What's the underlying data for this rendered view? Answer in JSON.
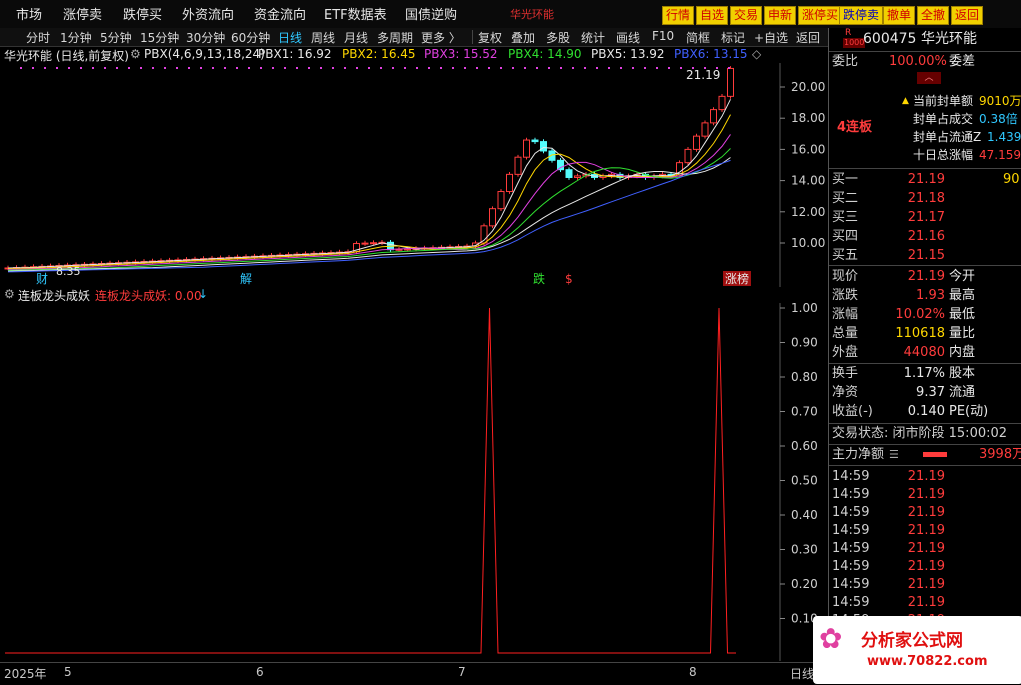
{
  "topbar": {
    "menus": [
      "市场",
      "涨停卖",
      "跌停买",
      "外资流向",
      "资金流向",
      "ETF数据表",
      "国债逆购",
      "华光环能"
    ],
    "buttons": [
      "行情",
      "自选",
      "交易",
      "申新",
      "涨停买",
      "跌停卖",
      "撤单",
      "全撤",
      "返回"
    ]
  },
  "periodbar": {
    "periods": [
      "分时",
      "1分钟",
      "5分钟",
      "15分钟",
      "30分钟",
      "60分钟",
      "日线",
      "周线",
      "月线",
      "多周期",
      "更多 〉"
    ],
    "active_period": "日线",
    "tools": [
      "复权",
      "叠加",
      "多股",
      "统计",
      "画线",
      "F10",
      "简框",
      "标记",
      "+自选",
      "返回"
    ]
  },
  "main_chart": {
    "title": "华光环能 (日线,前复权)",
    "indicator_name": "PBX(4,6,9,13,18,24)",
    "pbx": [
      {
        "label": "PBX1: 16.92",
        "color": "#e8e8e8"
      },
      {
        "label": "PBX2: 16.45",
        "color": "#ffd700"
      },
      {
        "label": "PBX3: 15.52",
        "color": "#e040e0"
      },
      {
        "label": "PBX4: 14.90",
        "color": "#30e030"
      },
      {
        "label": "PBX5: 13.92",
        "color": "#e8e8e8"
      },
      {
        "label": "PBX6: 13.15",
        "color": "#4060ff"
      }
    ],
    "y_ticks": [
      "20.00",
      "18.00",
      "16.00",
      "14.00",
      "12.00",
      "10.00"
    ],
    "last_price_label": "21.19",
    "low_label": "8.35",
    "markers": [
      "财",
      "解",
      "跌",
      "$",
      "涨榜"
    ]
  },
  "indicator": {
    "name": "连板龙头成妖",
    "value_label": "连板龙头成妖: 0.00",
    "y_ticks": [
      "1.00",
      "0.90",
      "0.80",
      "0.70",
      "0.60",
      "0.50",
      "0.40",
      "0.30",
      "0.20",
      "0.10"
    ]
  },
  "date_axis": {
    "labels": [
      "2025年",
      "5",
      "6",
      "7",
      "8"
    ],
    "period_label": "日线"
  },
  "chart_data": {
    "type": "line",
    "title": "",
    "xlabel": "",
    "ylabel": "",
    "ylim": [
      0,
      1.05
    ],
    "x": [
      0,
      1,
      2,
      3,
      4,
      5,
      6,
      7,
      8,
      9,
      10,
      11,
      12,
      13,
      14,
      15,
      16,
      17,
      18,
      19,
      20,
      21,
      22,
      23,
      24,
      25,
      26,
      27,
      28,
      29,
      30,
      31,
      32,
      33,
      34,
      35,
      36,
      37,
      38,
      39,
      40,
      41,
      42,
      43,
      44,
      45,
      46,
      47,
      48,
      49,
      50,
      51,
      52,
      53,
      54,
      55,
      56,
      57,
      58,
      59,
      60,
      61,
      62,
      63,
      64,
      65,
      66,
      67,
      68,
      69,
      70,
      71,
      72,
      73,
      74,
      75,
      76,
      77,
      78,
      79,
      80,
      81,
      82,
      83,
      84,
      85,
      86
    ],
    "series": [
      {
        "name": "连板龙头成妖",
        "values": [
          0,
          0,
          0,
          0,
          0,
          0,
          0,
          0,
          0,
          0,
          0,
          0,
          0,
          0,
          0,
          0,
          0,
          0,
          0,
          0,
          0,
          0,
          0,
          0,
          0,
          0,
          0,
          0,
          0,
          0,
          0,
          0,
          0,
          0,
          0,
          0,
          0,
          0,
          0,
          0,
          0,
          0,
          0,
          0,
          0,
          0,
          0,
          0,
          0,
          0,
          0,
          0,
          0,
          0,
          0,
          0,
          0,
          1,
          0,
          0,
          0,
          0,
          0,
          0,
          0,
          0,
          0,
          0,
          0,
          0,
          0,
          0,
          0,
          0,
          0,
          0,
          0,
          0,
          0,
          0,
          0,
          0,
          0,
          0,
          1,
          0,
          0
        ]
      }
    ]
  },
  "quote": {
    "code": "600475",
    "name": "华光环能",
    "r_badge": "R",
    "r_sub": "1000",
    "weibi_label": "委比",
    "weibi_value": "100.00%",
    "weicha_label": "委差",
    "lianban": "4连板",
    "seal_rows": [
      {
        "label": "当前封单额",
        "value": "9010万",
        "color": "#ffd700"
      },
      {
        "label": "封单占成交",
        "value": "0.38倍",
        "color": "#30c8ff"
      },
      {
        "label": "封单占流通Z",
        "value": "1.439",
        "color": "#30c8ff"
      },
      {
        "label": "十日总涨幅",
        "value": "47.159",
        "color": "#ff3c3c"
      }
    ],
    "bids": [
      {
        "label": "买一",
        "price": "21.19",
        "vol": "90"
      },
      {
        "label": "买二",
        "price": "21.18",
        "vol": ""
      },
      {
        "label": "买三",
        "price": "21.17",
        "vol": ""
      },
      {
        "label": "买四",
        "price": "21.16",
        "vol": ""
      },
      {
        "label": "买五",
        "price": "21.15",
        "vol": ""
      }
    ],
    "stats": [
      {
        "l1": "现价",
        "v1": "21.19",
        "c1": "#ff3c3c",
        "l2": "今开"
      },
      {
        "l1": "涨跌",
        "v1": "1.93",
        "c1": "#ff3c3c",
        "l2": "最高"
      },
      {
        "l1": "涨幅",
        "v1": "10.02%",
        "c1": "#ff3c3c",
        "l2": "最低"
      },
      {
        "l1": "总量",
        "v1": "110618",
        "c1": "#ffd700",
        "l2": "量比"
      },
      {
        "l1": "外盘",
        "v1": "44080",
        "c1": "#ff3c3c",
        "l2": "内盘"
      }
    ],
    "stats2": [
      {
        "l1": "换手",
        "v1": "1.17%",
        "c1": "#e8e8e8",
        "l2": "股本"
      },
      {
        "l1": "净资",
        "v1": "9.37",
        "c1": "#e8e8e8",
        "l2": "流通"
      },
      {
        "l1": "收益(-)",
        "v1": "0.140",
        "c1": "#e8e8e8",
        "l2": "PE(动)"
      }
    ],
    "trade_status": "交易状态: 闭市阶段 15:00:02",
    "main_net_label": "主力净额",
    "main_net_value": "3998万",
    "ticks": [
      {
        "time": "14:59",
        "price": "21.19"
      },
      {
        "time": "14:59",
        "price": "21.19"
      },
      {
        "time": "14:59",
        "price": "21.19"
      },
      {
        "time": "14:59",
        "price": "21.19"
      },
      {
        "time": "14:59",
        "price": "21.19"
      },
      {
        "time": "14:59",
        "price": "21.19"
      },
      {
        "time": "14:59",
        "price": "21.19"
      },
      {
        "time": "14:59",
        "price": "21.19"
      },
      {
        "time": "14:59",
        "price": "21.19"
      }
    ]
  },
  "watermark": {
    "text": "分析家公式网",
    "url": "www.70822.com"
  }
}
